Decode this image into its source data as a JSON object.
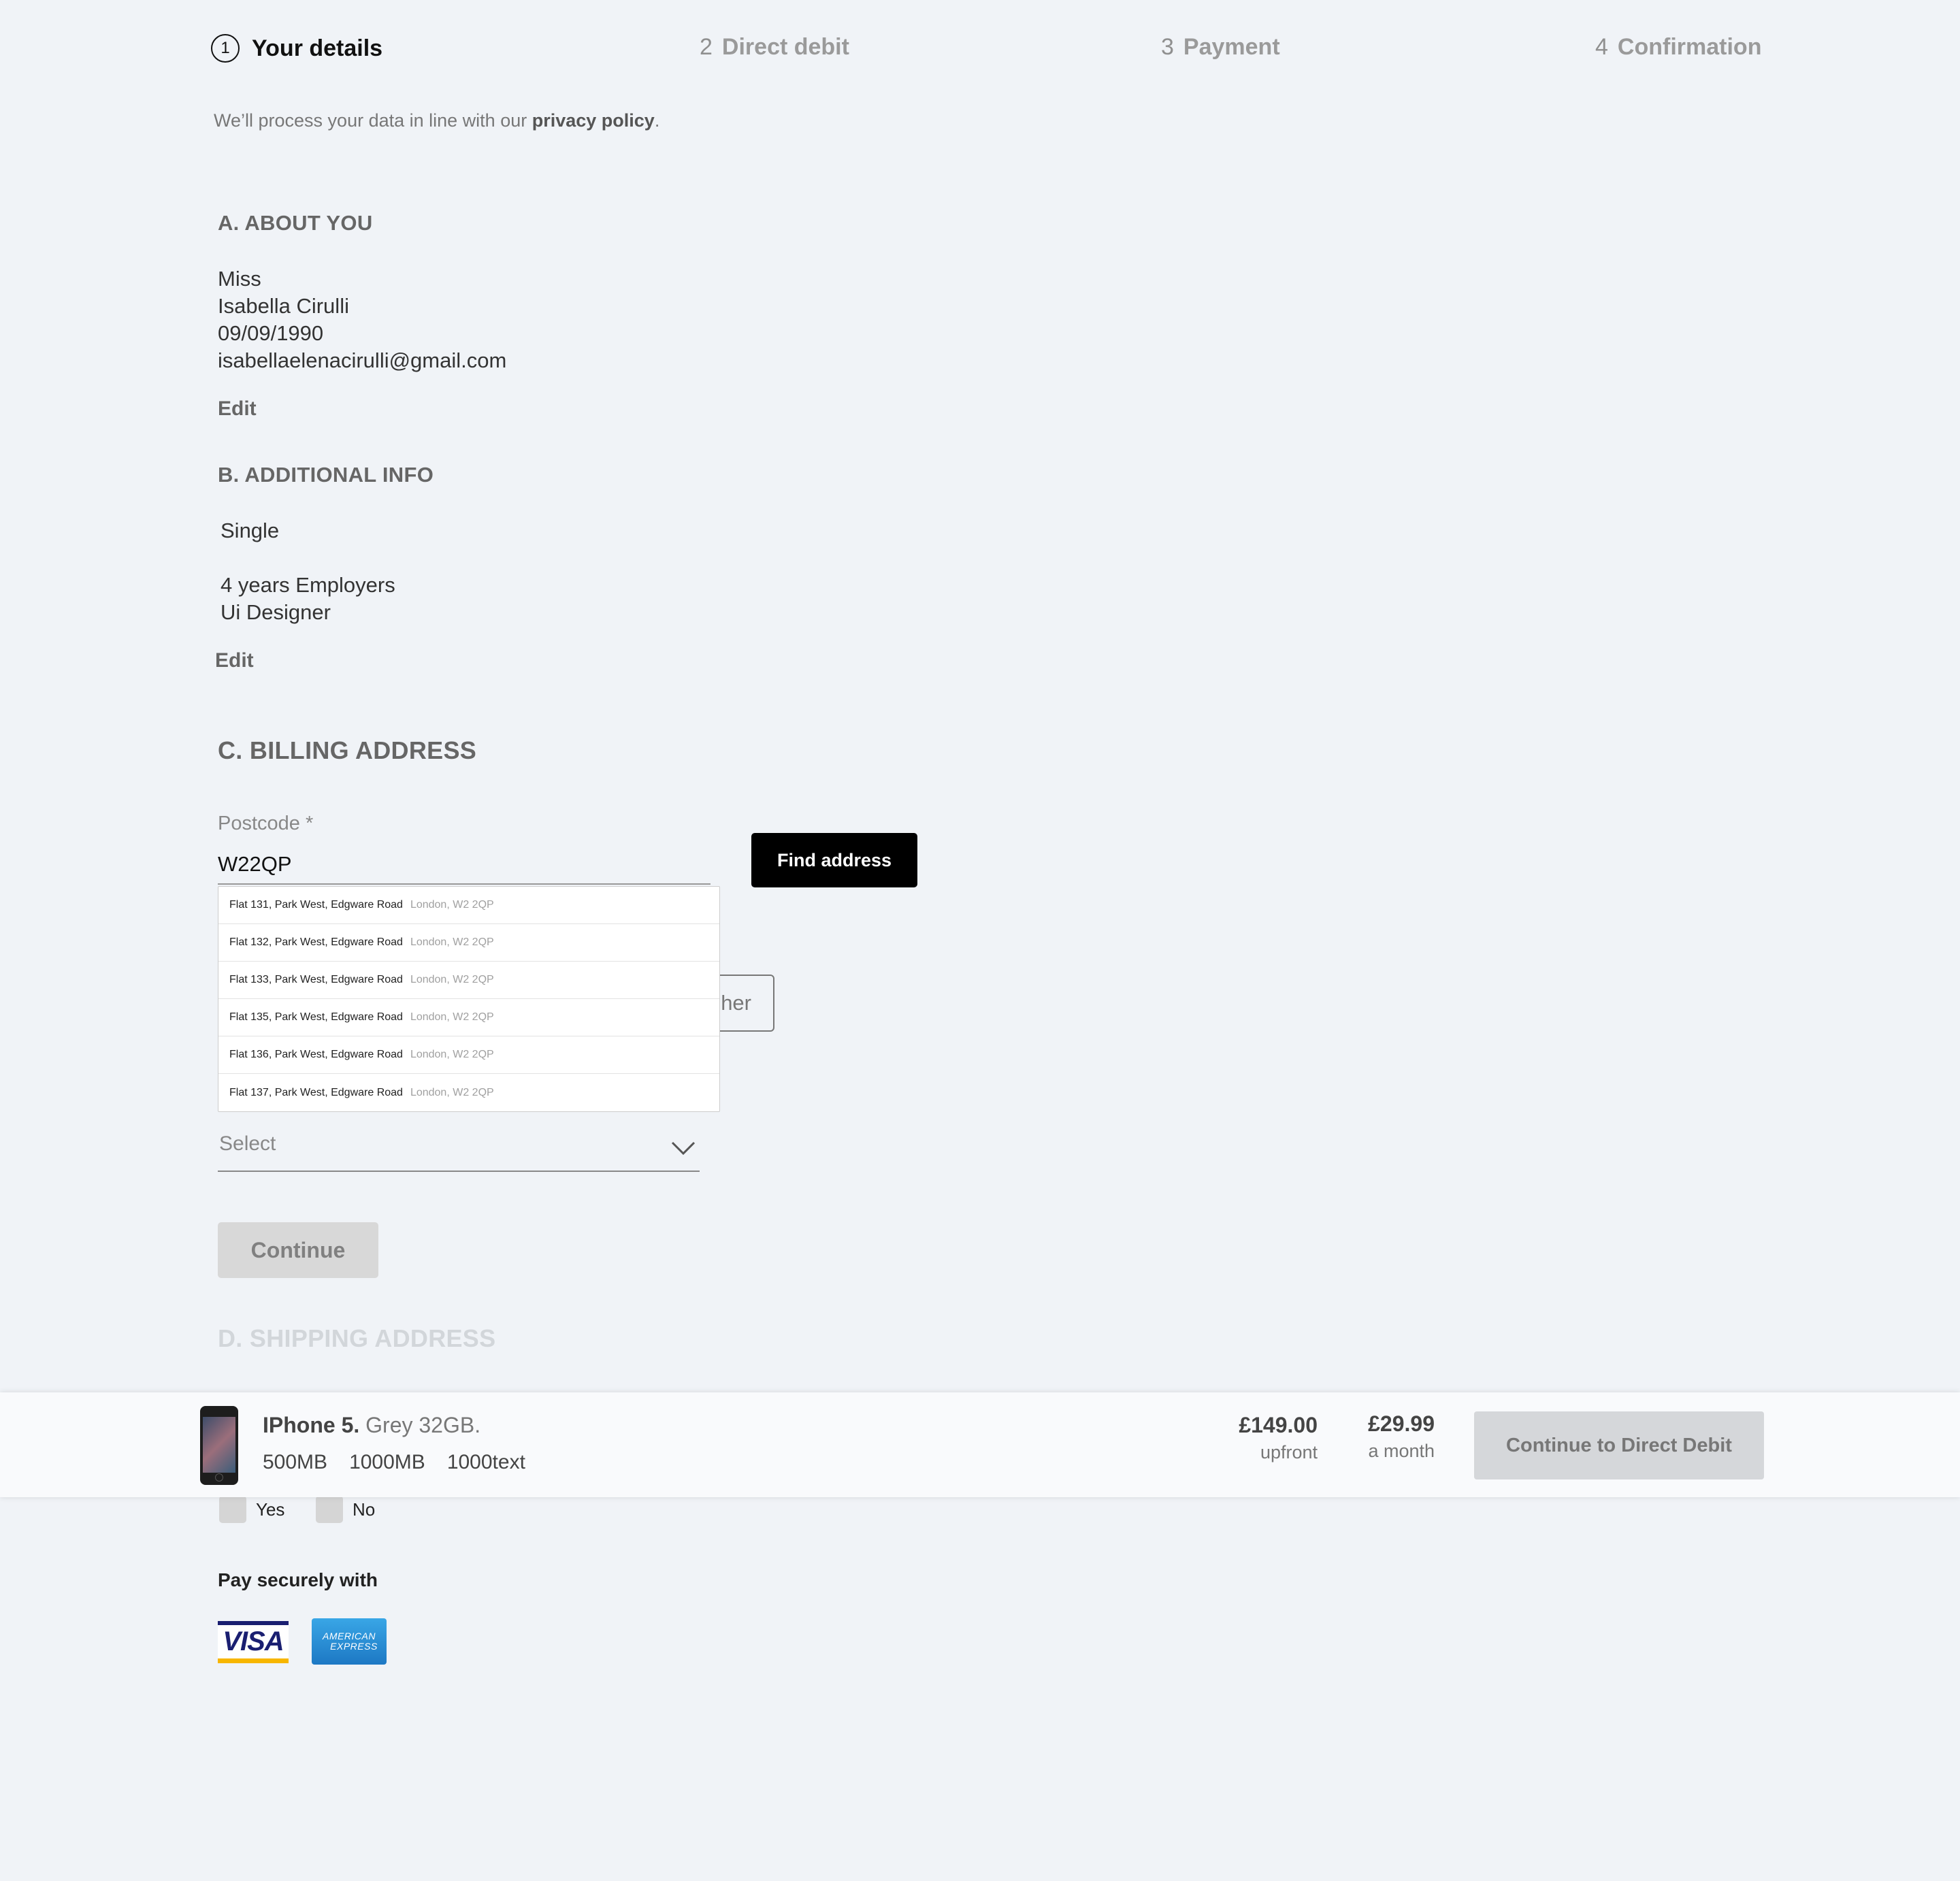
{
  "stepper": [
    {
      "num": "1",
      "label": "Your details"
    },
    {
      "num": "2",
      "label": "Direct debit"
    },
    {
      "num": "3",
      "label": "Payment"
    },
    {
      "num": "4",
      "label": "Confirmation"
    }
  ],
  "privacy": {
    "prefix": "We’ll process your data in line with our ",
    "link": "privacy policy",
    "suffix": "."
  },
  "about": {
    "heading": "A. ABOUT YOU",
    "title": "Miss",
    "name": "Isabella Cirulli",
    "dob": "09/09/1990",
    "email": "isabellaelenacirulli@gmail.com",
    "edit": "Edit"
  },
  "additional": {
    "heading": "B. ADDITIONAL INFO",
    "status": "Single",
    "employment": "4 years Employers",
    "job": "Ui Designer",
    "edit": "Edit"
  },
  "billing": {
    "heading": "C. BILLING ADDRESS",
    "postcode_label": "Postcode *",
    "postcode_value": "W22QP",
    "find_button": "Find address",
    "other_button": "her",
    "select_placeholder": "Select",
    "continue": "Continue",
    "suggestions": [
      {
        "address": "Flat 131, Park West, Edgware Road",
        "city": "London, W2 2QP"
      },
      {
        "address": "Flat 132, Park West, Edgware Road",
        "city": "London, W2 2QP"
      },
      {
        "address": "Flat 133, Park West, Edgware Road",
        "city": "London, W2 2QP"
      },
      {
        "address": "Flat 135, Park West, Edgware Road",
        "city": "London, W2 2QP"
      },
      {
        "address": "Flat 136, Park West, Edgware Road",
        "city": "London, W2 2QP"
      },
      {
        "address": "Flat 137, Park West, Edgware Road",
        "city": "London, W2 2QP"
      }
    ]
  },
  "shipping": {
    "heading": "D. SHIPPING ADDRESS",
    "yes": "Yes",
    "no": "No"
  },
  "payment": {
    "title": "Pay securely with",
    "visa": "VISA",
    "amex_line1": "AMERICAN",
    "amex_line2": "EXPRESS"
  },
  "bar": {
    "product_name": "IPhone 5.",
    "product_variant": " Grey 32GB.",
    "specs": [
      "500MB",
      "1000MB",
      "1000text"
    ],
    "upfront_amount": "£149.00",
    "upfront_label": "upfront",
    "monthly_amount": "£29.99",
    "monthly_label": "a month",
    "cta": "Continue to Direct Debit"
  }
}
